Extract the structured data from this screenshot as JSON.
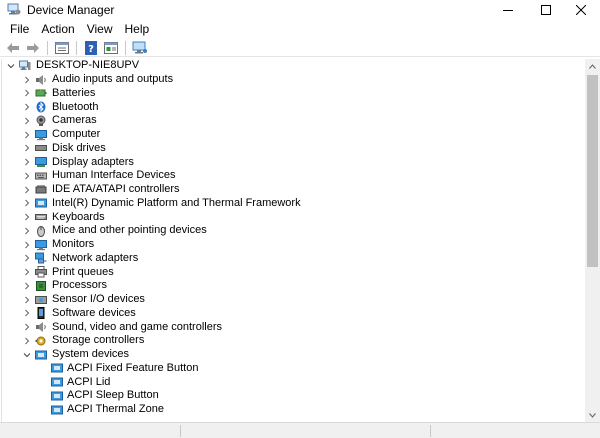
{
  "window": {
    "title": "Device Manager"
  },
  "menu": {
    "items": [
      "File",
      "Action",
      "View",
      "Help"
    ]
  },
  "toolbar": {
    "buttons": [
      "back-icon",
      "forward-icon",
      "properties-icon",
      "help-icon",
      "show-hidden-icon",
      "monitor-icon"
    ]
  },
  "tree": {
    "root": "DESKTOP-NIE8UPV",
    "categories": [
      {
        "label": "Audio inputs and outputs",
        "icon": "speaker-icon"
      },
      {
        "label": "Batteries",
        "icon": "battery-icon"
      },
      {
        "label": "Bluetooth",
        "icon": "bluetooth-icon"
      },
      {
        "label": "Cameras",
        "icon": "camera-icon"
      },
      {
        "label": "Computer",
        "icon": "computer-icon"
      },
      {
        "label": "Disk drives",
        "icon": "disk-drive-icon"
      },
      {
        "label": "Display adapters",
        "icon": "display-adapter-icon"
      },
      {
        "label": "Human Interface Devices",
        "icon": "hid-icon"
      },
      {
        "label": "IDE ATA/ATAPI controllers",
        "icon": "ide-controller-icon"
      },
      {
        "label": "Intel(R) Dynamic Platform and Thermal Framework",
        "icon": "device-folder-icon"
      },
      {
        "label": "Keyboards",
        "icon": "keyboard-icon"
      },
      {
        "label": "Mice and other pointing devices",
        "icon": "mouse-icon"
      },
      {
        "label": "Monitors",
        "icon": "monitor-icon"
      },
      {
        "label": "Network adapters",
        "icon": "network-adapter-icon"
      },
      {
        "label": "Print queues",
        "icon": "printer-icon"
      },
      {
        "label": "Processors",
        "icon": "processor-icon"
      },
      {
        "label": "Sensor I/O devices",
        "icon": "sensor-icon"
      },
      {
        "label": "Software devices",
        "icon": "software-device-icon"
      },
      {
        "label": "Sound, video and game controllers",
        "icon": "sound-controller-icon"
      },
      {
        "label": "Storage controllers",
        "icon": "storage-controller-icon"
      },
      {
        "label": "System devices",
        "icon": "system-devices-icon"
      }
    ],
    "system_devices": [
      "ACPI Fixed Feature Button",
      "ACPI Lid",
      "ACPI Sleep Button",
      "ACPI Thermal Zone"
    ]
  },
  "colors": {
    "folder_blue": "#2b7ad6",
    "chevron": "#606060",
    "scroll_thumb": "#c1c1c1"
  }
}
